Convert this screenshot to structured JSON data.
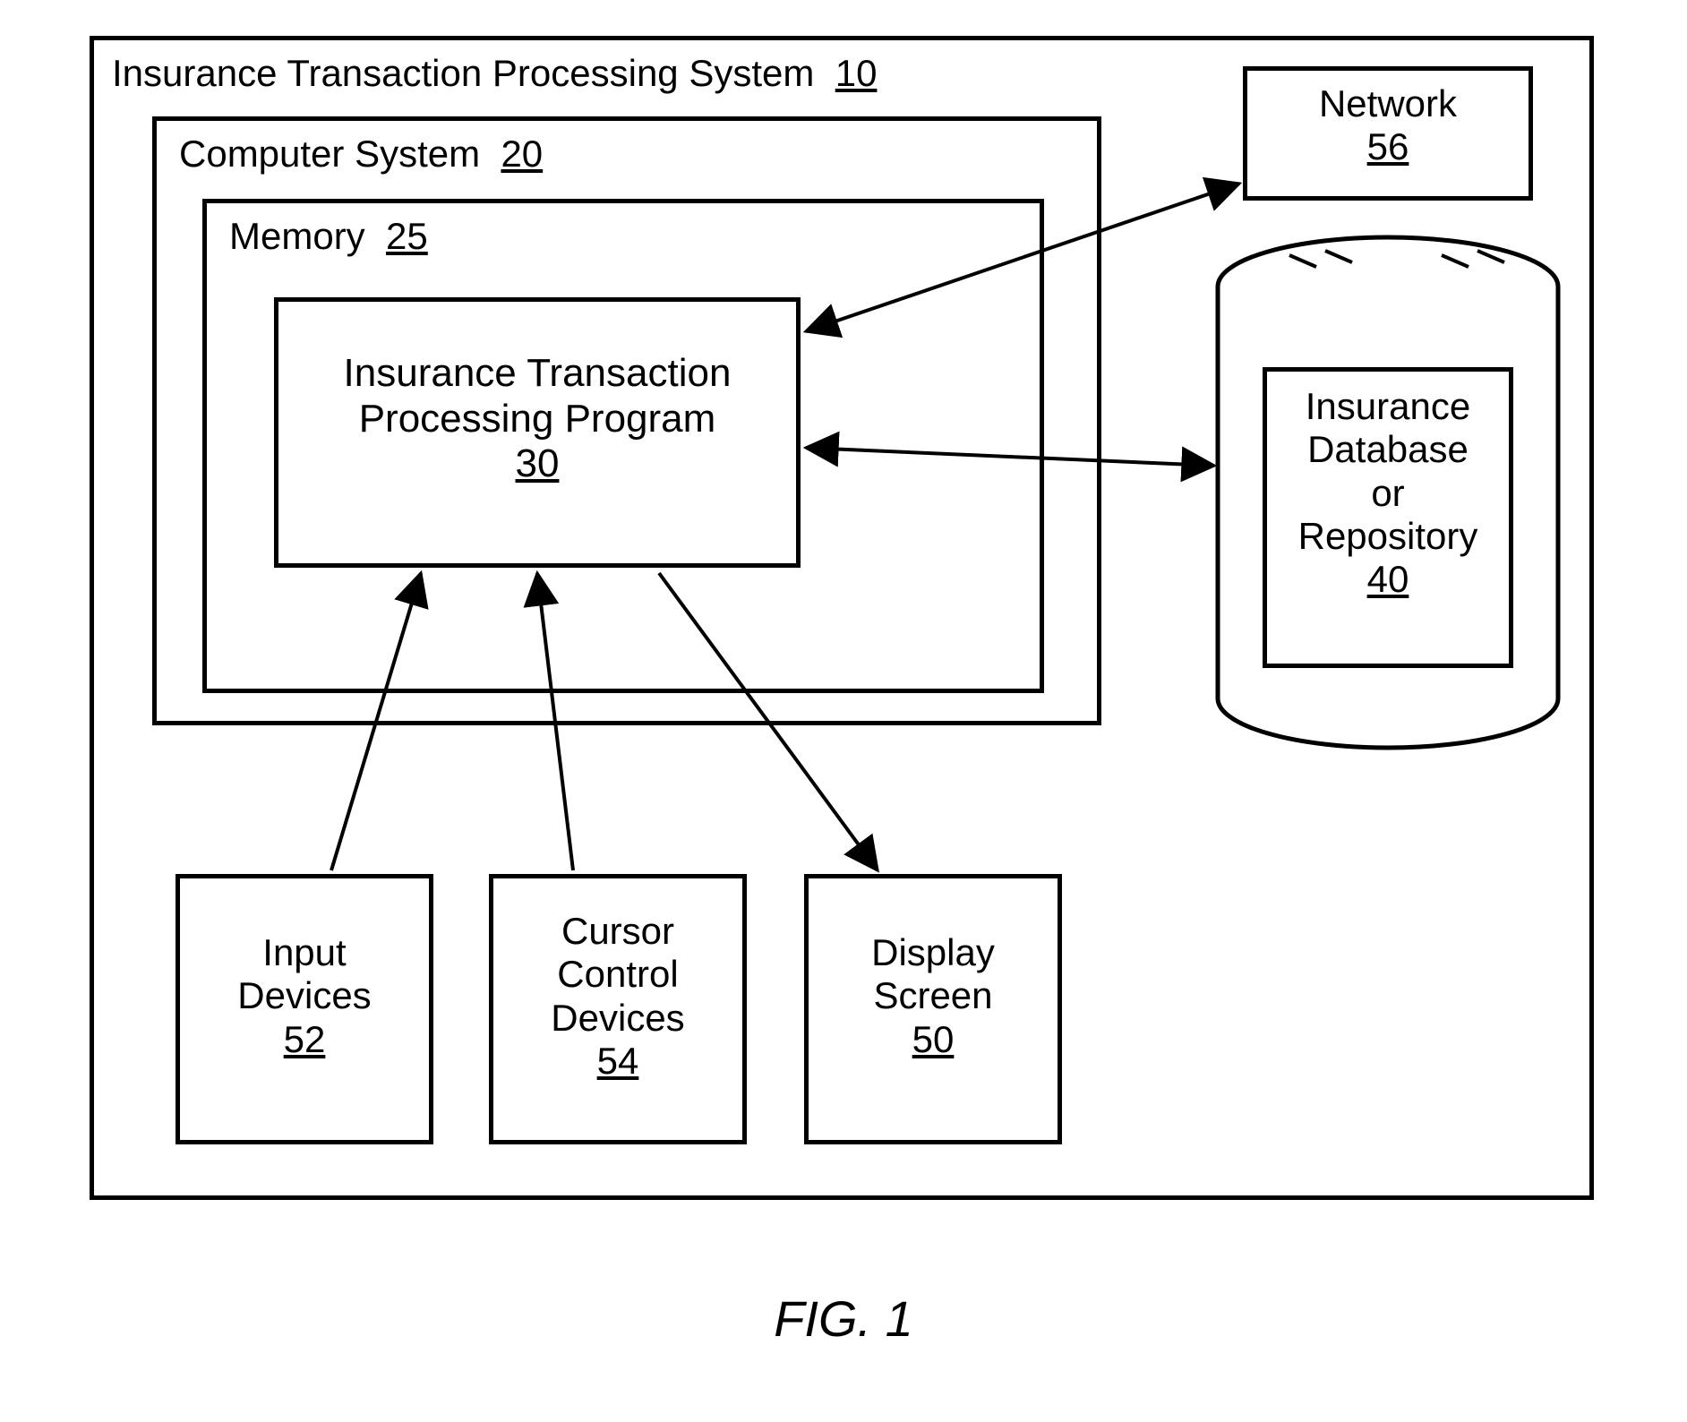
{
  "figure_caption": "FIG. 1",
  "system": {
    "title": "Insurance Transaction Processing System",
    "ref": "10",
    "computer_system": {
      "title": "Computer System",
      "ref": "20",
      "memory": {
        "title": "Memory",
        "ref": "25",
        "program": {
          "title_line1": "Insurance Transaction",
          "title_line2": "Processing Program",
          "ref": "30"
        }
      }
    },
    "network": {
      "title": "Network",
      "ref": "56"
    },
    "database": {
      "title_line1": "Insurance",
      "title_line2": "Database",
      "title_line3": "or",
      "title_line4": "Repository",
      "ref": "40"
    },
    "input_devices": {
      "title_line1": "Input",
      "title_line2": "Devices",
      "ref": "52"
    },
    "cursor_control": {
      "title_line1": "Cursor",
      "title_line2": "Control",
      "title_line3": "Devices",
      "ref": "54"
    },
    "display": {
      "title_line1": "Display",
      "title_line2": "Screen",
      "ref": "50"
    }
  }
}
